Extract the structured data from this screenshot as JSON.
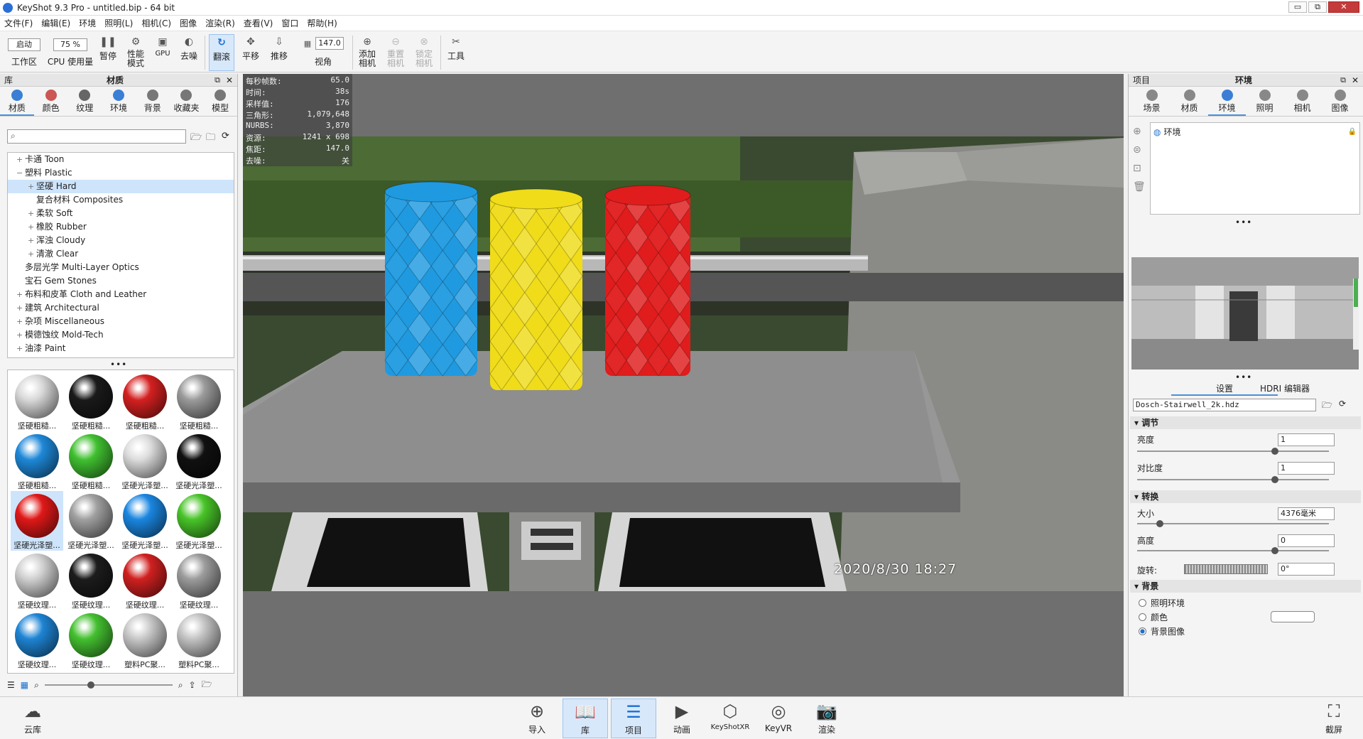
{
  "window": {
    "title": "KeyShot 9.3 Pro  - untitled.bip  - 64 bit",
    "minimize": "▭",
    "restore": "⧉",
    "close": "✕"
  },
  "menu": [
    "文件(F)",
    "编辑(E)",
    "环境",
    "照明(L)",
    "相机(C)",
    "图像",
    "渲染(R)",
    "查看(V)",
    "窗口",
    "帮助(H)"
  ],
  "toolbar": {
    "workspace_select": "启动",
    "workspace_label": "工作区",
    "cpu_select": "75 %",
    "cpu_label": "CPU 使用量",
    "pause_label": "暂停",
    "perf_label": "性能\n模式",
    "gpu_label": "GPU",
    "denoise_label": "去噪",
    "tumble_label": "翻滚",
    "pan_label": "平移",
    "dolly_label": "推移",
    "fov_value": "147.0",
    "fov_label": "视角",
    "add_camera_label": "添加\n相机",
    "reset_camera_label": "重置\n相机",
    "lock_camera_label": "锁定\n相机",
    "tools_label": "工具"
  },
  "library": {
    "header_left": "库",
    "header_title": "材质",
    "tabs": [
      {
        "label": "材质",
        "icon": "material-icon"
      },
      {
        "label": "颜色",
        "icon": "color-icon"
      },
      {
        "label": "纹理",
        "icon": "texture-icon"
      },
      {
        "label": "环境",
        "icon": "environment-icon"
      },
      {
        "label": "背景",
        "icon": "background-icon"
      },
      {
        "label": "收藏夹",
        "icon": "favorites-icon"
      },
      {
        "label": "模型",
        "icon": "model-icon"
      }
    ],
    "search_placeholder": "",
    "tree": [
      {
        "label": "卡通 Toon",
        "toggle": "+",
        "level": 0
      },
      {
        "label": "塑料 Plastic",
        "toggle": "−",
        "level": 0
      },
      {
        "label": "坚硬 Hard",
        "toggle": "+",
        "level": 1,
        "selected": true
      },
      {
        "label": "复合材料 Composites",
        "toggle": "",
        "level": 1
      },
      {
        "label": "柔软 Soft",
        "toggle": "+",
        "level": 1
      },
      {
        "label": "橡胶 Rubber",
        "toggle": "+",
        "level": 1
      },
      {
        "label": "浑浊 Cloudy",
        "toggle": "+",
        "level": 1
      },
      {
        "label": "清澈 Clear",
        "toggle": "+",
        "level": 1
      },
      {
        "label": "多层光学 Multi-Layer Optics",
        "toggle": "",
        "level": 0
      },
      {
        "label": "宝石 Gem Stones",
        "toggle": "",
        "level": 0
      },
      {
        "label": "布料和皮革 Cloth and Leather",
        "toggle": "+",
        "level": 0
      },
      {
        "label": "建筑 Architectural",
        "toggle": "+",
        "level": 0
      },
      {
        "label": "杂项 Miscellaneous",
        "toggle": "+",
        "level": 0
      },
      {
        "label": "模德蚀纹 Mold-Tech",
        "toggle": "+",
        "level": 0
      },
      {
        "label": "油漆 Paint",
        "toggle": "+",
        "level": 0
      }
    ],
    "thumbnails": [
      {
        "caption": "坚硬粗糙...",
        "color": "#d8d8d8"
      },
      {
        "caption": "坚硬粗糙...",
        "color": "#1a1a1a"
      },
      {
        "caption": "坚硬粗糙...",
        "color": "#d42020"
      },
      {
        "caption": "坚硬粗糙...",
        "color": "#9a9a9a"
      },
      {
        "caption": "坚硬粗糙...",
        "color": "#1e88d8"
      },
      {
        "caption": "坚硬粗糙...",
        "color": "#40c030"
      },
      {
        "caption": "坚硬光泽塑...",
        "color": "#dcdcdc"
      },
      {
        "caption": "坚硬光泽塑...",
        "color": "#101010"
      },
      {
        "caption": "坚硬光泽塑...",
        "color": "#e01818"
      },
      {
        "caption": "坚硬光泽塑...",
        "color": "#a0a0a0"
      },
      {
        "caption": "坚硬光泽塑...",
        "color": "#1a86e0"
      },
      {
        "caption": "坚硬光泽塑...",
        "color": "#48c428"
      },
      {
        "caption": "坚硬纹理...",
        "color": "#d0d0d0"
      },
      {
        "caption": "坚硬纹理...",
        "color": "#1c1c1c"
      },
      {
        "caption": "坚硬纹理...",
        "color": "#d02020"
      },
      {
        "caption": "坚硬纹理...",
        "color": "#9c9c9c"
      },
      {
        "caption": "坚硬纹理...",
        "color": "#1e84d4"
      },
      {
        "caption": "坚硬纹理...",
        "color": "#44c030"
      },
      {
        "caption": "塑料PC聚...",
        "color": "#c8c8c8"
      },
      {
        "caption": "塑料PC聚...",
        "color": "#c4c4c4"
      }
    ]
  },
  "viewport": {
    "stats": [
      {
        "label": "每秒帧数:",
        "value": "65.0"
      },
      {
        "label": "时间:",
        "value": "38s"
      },
      {
        "label": "采样值:",
        "value": "176"
      },
      {
        "label": "三角形:",
        "value": "1,079,648"
      },
      {
        "label": "NURBS:",
        "value": "3,870"
      },
      {
        "label": "资源:",
        "value": "1241 x 698"
      },
      {
        "label": "焦距:",
        "value": "147.0"
      },
      {
        "label": "去噪:",
        "value": "关"
      }
    ],
    "timestamp": "2020/8/30  18:27",
    "vases": [
      {
        "color": "#1f9ae0"
      },
      {
        "color": "#f0dc18"
      },
      {
        "color": "#e01c1c"
      }
    ]
  },
  "project": {
    "header_left": "项目",
    "header_title": "环境",
    "tabs": [
      {
        "label": "场景",
        "icon": "scene-icon"
      },
      {
        "label": "材质",
        "icon": "material-icon"
      },
      {
        "label": "环境",
        "icon": "environment-icon"
      },
      {
        "label": "照明",
        "icon": "lighting-icon"
      },
      {
        "label": "相机",
        "icon": "camera-icon"
      },
      {
        "label": "图像",
        "icon": "image-icon"
      }
    ],
    "env_item": "环境",
    "subtabs": [
      "设置",
      "HDRI 编辑器"
    ],
    "hdr_file": "Dosch-Stairwell_2k.hdz",
    "sections": {
      "adjust": "调节",
      "transform": "转换",
      "background": "背景"
    },
    "brightness_label": "亮度",
    "brightness_value": "1",
    "brightness_level": 0.72,
    "contrast_label": "对比度",
    "contrast_value": "1",
    "contrast_level": 0.72,
    "size_label": "大小",
    "size_value": "4376毫米",
    "size_level": 0.12,
    "height_label": "高度",
    "height_value": "0",
    "height_level": 0.72,
    "rotation_label": "旋转:",
    "rotation_value": "0°",
    "bg_options": [
      {
        "label": "照明环境",
        "checked": false
      },
      {
        "label": "颜色",
        "checked": false
      },
      {
        "label": "背景图像",
        "checked": true
      }
    ]
  },
  "bottombar": {
    "cloud": "云库",
    "items": [
      {
        "label": "导入",
        "icon": "import-icon",
        "active": false
      },
      {
        "label": "库",
        "icon": "library-icon",
        "active": true
      },
      {
        "label": "项目",
        "icon": "project-icon",
        "active": true
      },
      {
        "label": "动画",
        "icon": "animation-icon",
        "active": false
      },
      {
        "label": "KeyShotXR",
        "icon": "keyshotxr-icon",
        "active": false
      },
      {
        "label": "KeyVR",
        "icon": "keyvr-icon",
        "active": false
      },
      {
        "label": "渲染",
        "icon": "render-icon",
        "active": false
      }
    ],
    "screenshot": "截屏"
  }
}
